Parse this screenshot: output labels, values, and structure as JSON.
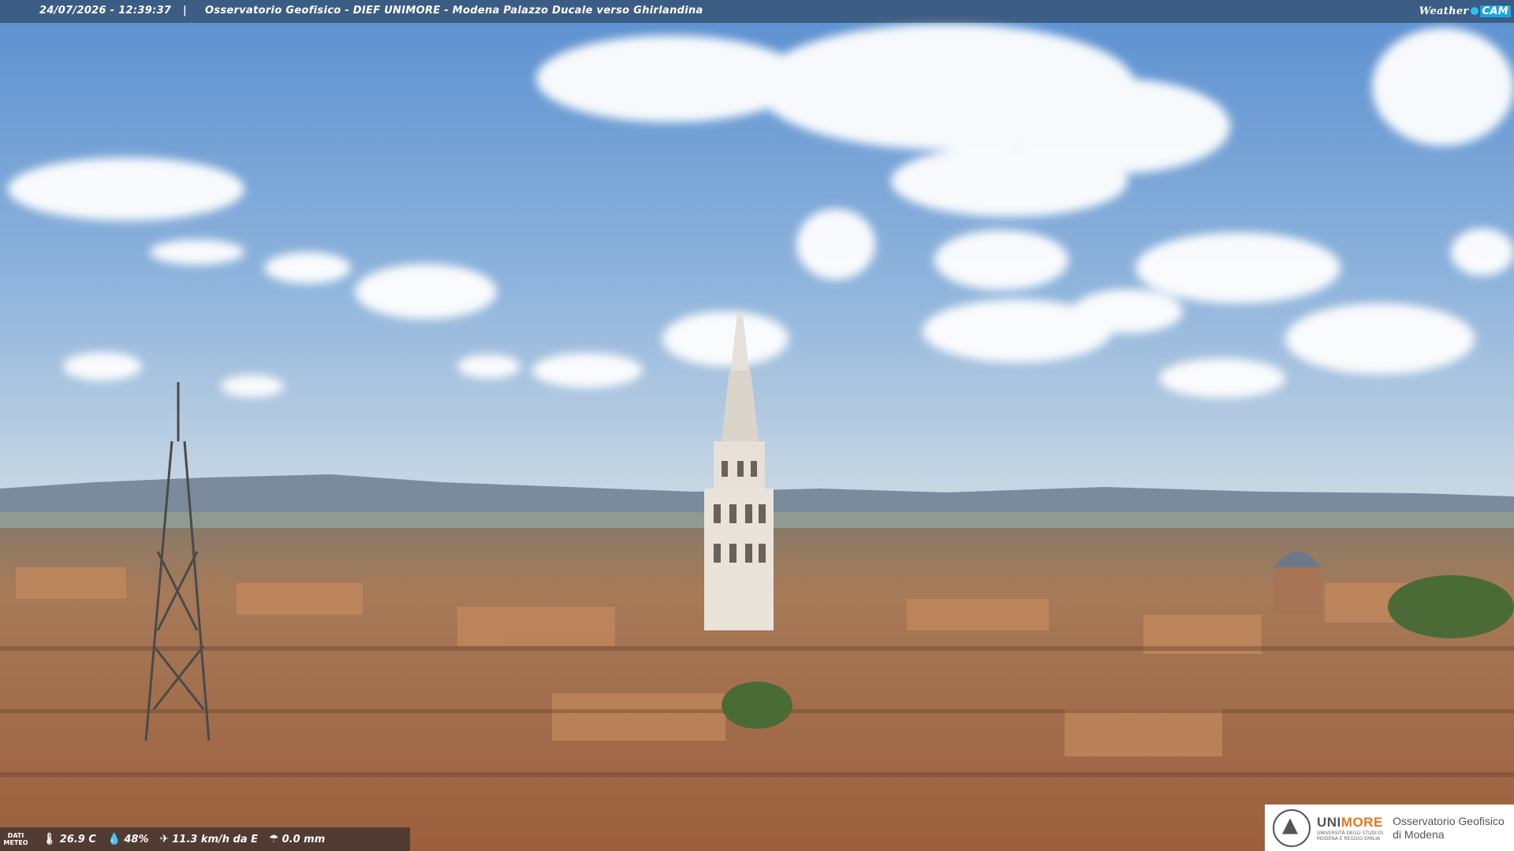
{
  "header": {
    "timestamp": "24/07/2026 - 12:39:37",
    "separator": "|",
    "title": "Osservatorio Geofisico - DIEF UNIMORE - Modena Palazzo Ducale verso Ghirlandina",
    "brand_weather": "Weather",
    "brand_cam": "CAM"
  },
  "meteo": {
    "label_line1": "DATI",
    "label_line2": "METEO",
    "temperature": "26.9 C",
    "humidity": "48%",
    "wind": "11.3 km/h da E",
    "rain": "0.0 mm",
    "icons": [
      "thermometer-icon",
      "humidity-icon",
      "wind-icon",
      "rain-icon"
    ]
  },
  "logo": {
    "uni_prefix": "UNI",
    "uni_suffix": "MORE",
    "uni_sub1": "UNIVERSITÀ DEGLI STUDI DI",
    "uni_sub2": "MODENA E REGGIO EMILIA",
    "obs_line1": "Osservatorio Geofisico",
    "obs_line2": "di Modena"
  },
  "colors": {
    "sky_top": "#5e93d2",
    "sky_horizon": "#c9d9e6",
    "roof": "#b5714a",
    "accent_orange": "#e07a1f"
  }
}
